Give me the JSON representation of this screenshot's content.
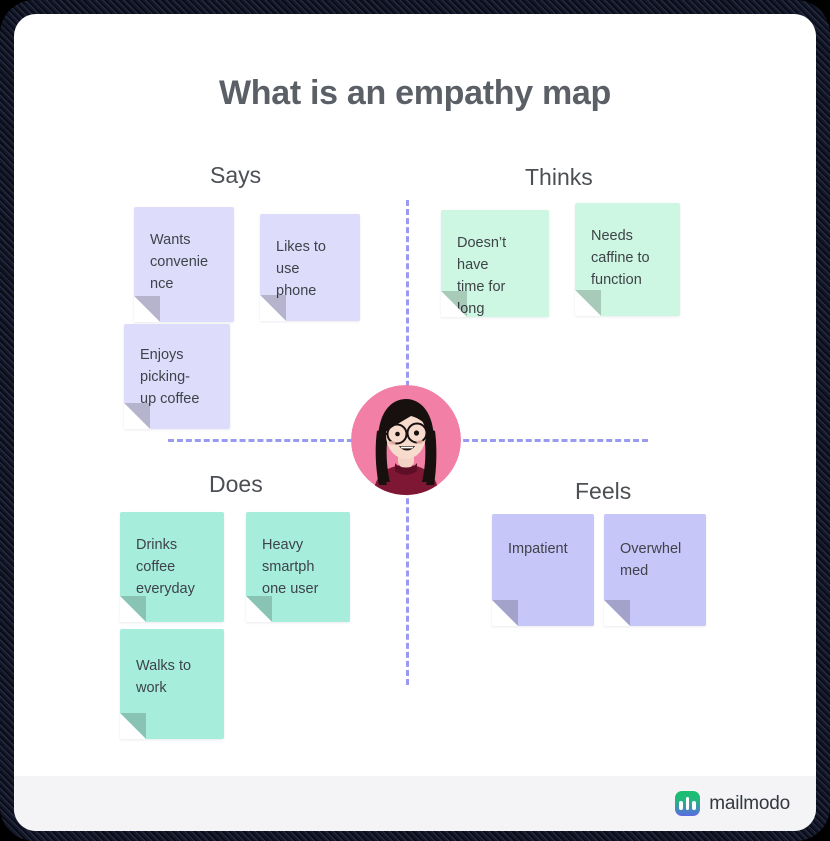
{
  "header": {
    "title": "What is an empathy map"
  },
  "colors": {
    "says_note": "#DEDCFB",
    "thinks_note": "#CDF7E2",
    "does_note": "#A6EEDB",
    "feels_note": "#C6C6F8",
    "divider": "#9A9AF0",
    "avatar_bg": "#F27FA5",
    "title_text": "#5B5F66",
    "brand_green": "#18BF6E",
    "brand_purple": "#5B6AE6"
  },
  "quadrants": [
    {
      "key": "says",
      "label": "Says",
      "notes": [
        {
          "text": "Wants\nconvenie\nnce"
        },
        {
          "text": "Likes to\nuse\nphone"
        },
        {
          "text": "Enjoys\npicking-\nup coffee"
        }
      ]
    },
    {
      "key": "thinks",
      "label": "Thinks",
      "notes": [
        {
          "text": "Doesn’t have\ntime for long\nlines"
        },
        {
          "text": "Needs\ncaffine to\nfunction"
        }
      ]
    },
    {
      "key": "does",
      "label": "Does",
      "notes": [
        {
          "text": "Drinks\ncoffee\neveryday"
        },
        {
          "text": "Heavy\nsmartph\none user"
        },
        {
          "text": "Walks to\nwork"
        }
      ]
    },
    {
      "key": "feels",
      "label": "Feels",
      "notes": [
        {
          "text": "Impatient"
        },
        {
          "text": "Overwhel\nmed"
        }
      ]
    }
  ],
  "persona": {
    "icon": "user-avatar-illustration"
  },
  "footer": {
    "brand_name": "mailmodo",
    "brand_icon": "mailmodo-logo-icon"
  }
}
